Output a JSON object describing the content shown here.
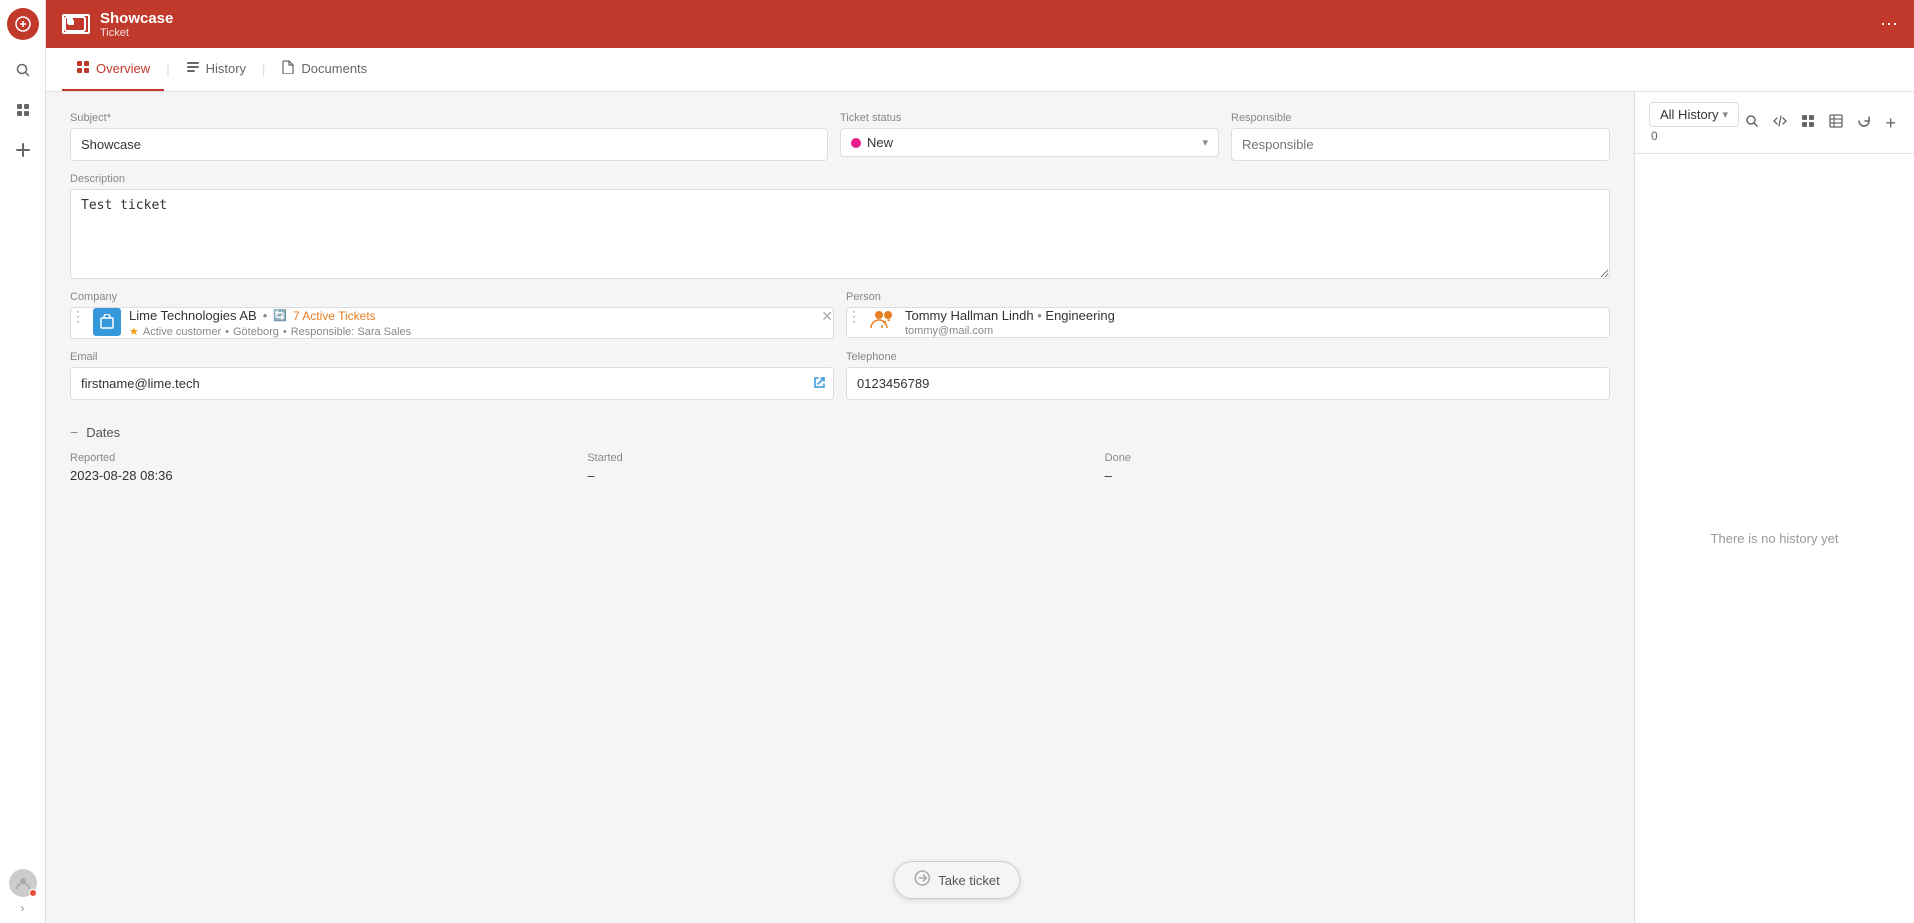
{
  "app": {
    "title": "Showcase",
    "subtitle": "Ticket"
  },
  "header": {
    "title": "Showcase",
    "subtitle": "Ticket",
    "ellipsis": "⋯"
  },
  "tabs": [
    {
      "id": "overview",
      "label": "Overview",
      "icon": "▦",
      "active": true
    },
    {
      "id": "history",
      "label": "History",
      "icon": "☰",
      "active": false
    },
    {
      "id": "documents",
      "label": "Documents",
      "icon": "📎",
      "active": false
    }
  ],
  "right_panel": {
    "all_history_label": "All History",
    "all_history_count": "0",
    "no_history_text": "There is no history yet"
  },
  "form": {
    "subject_label": "Subject*",
    "subject_value": "Showcase",
    "ticket_status_label": "Ticket status",
    "ticket_status_value": "New",
    "responsible_label": "Responsible",
    "responsible_placeholder": "Responsible",
    "description_label": "Description",
    "description_value": "Test ticket",
    "company_label": "Company",
    "company_name": "Lime Technologies AB",
    "company_active_tickets": "7 Active Tickets",
    "company_active_tickets_icon": "🔄",
    "company_status": "Active customer",
    "company_location": "Göteborg",
    "company_responsible": "Responsible: Sara Sales",
    "person_label": "Person",
    "person_name": "Tommy Hallman Lindh",
    "person_department": "Engineering",
    "person_email": "tommy@mail.com",
    "email_label": "Email",
    "email_value": "firstname@lime.tech",
    "telephone_label": "Telephone",
    "telephone_value": "0123456789",
    "dates_section_label": "Dates",
    "reported_label": "Reported",
    "reported_value": "2023-08-28 08:36",
    "started_label": "Started",
    "started_value": "–",
    "done_label": "Done",
    "done_value": "–"
  },
  "take_ticket_button": "Take ticket",
  "icons": {
    "search": "🔍",
    "code": "</>",
    "grid": "⊞",
    "table": "⊟",
    "refresh": "↻",
    "add": "+",
    "chevron_down": "▾",
    "minus": "−",
    "dots": "⋮"
  }
}
